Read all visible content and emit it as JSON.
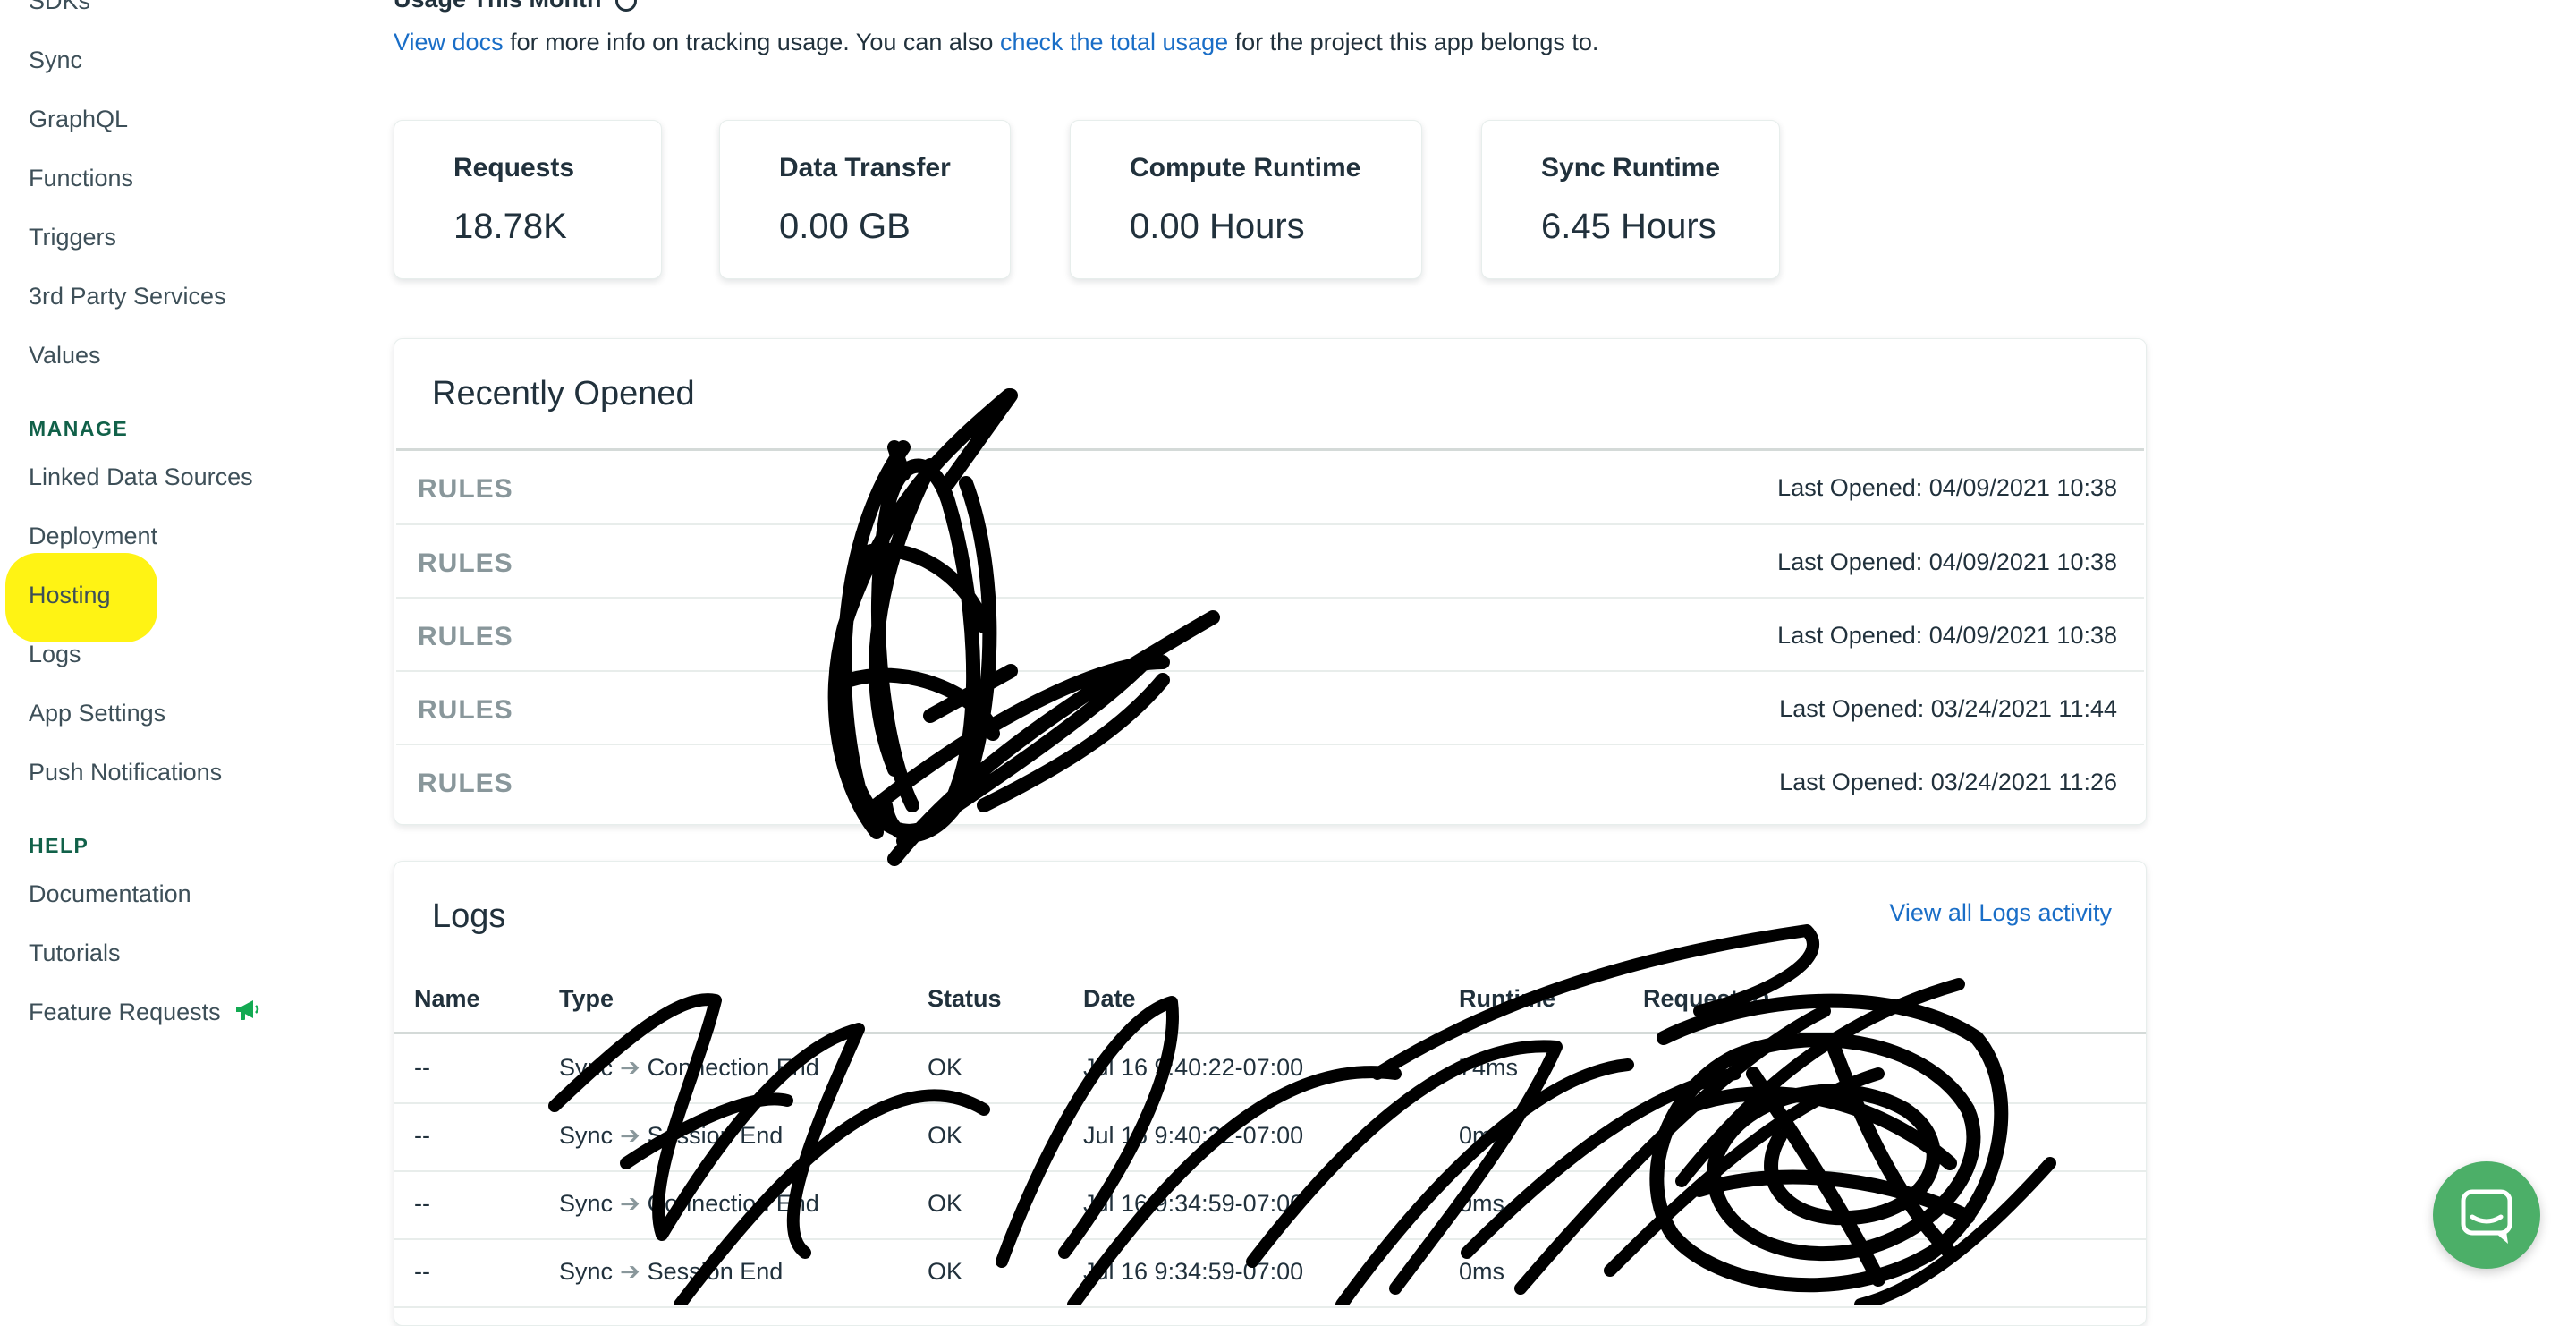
{
  "sidebar": {
    "items_top": [
      "SDKs",
      "Sync",
      "GraphQL",
      "Functions",
      "Triggers",
      "3rd Party Services",
      "Values"
    ],
    "manage_heading": "MANAGE",
    "manage_items": [
      "Linked Data Sources",
      "Deployment",
      "Hosting",
      "Logs",
      "App Settings",
      "Push Notifications"
    ],
    "help_heading": "HELP",
    "help_items": [
      "Documentation",
      "Tutorials",
      "Feature Requests"
    ],
    "highlight_color": "#fff200"
  },
  "usage": {
    "heading": "Usage This Month",
    "link_docs": "View docs",
    "text_1": " for more info on tracking usage. You can also ",
    "link_total": "check the total usage",
    "text_2": " for the project this app belongs to."
  },
  "cards": [
    {
      "label": "Requests",
      "value": "18.78K"
    },
    {
      "label": "Data Transfer",
      "value": "0.00 GB"
    },
    {
      "label": "Compute Runtime",
      "value": "0.00 Hours"
    },
    {
      "label": "Sync Runtime",
      "value": "6.45 Hours"
    }
  ],
  "recently_opened": {
    "title": "Recently Opened",
    "rows": [
      {
        "name": "RULES",
        "last_opened": "Last Opened: 04/09/2021 10:38"
      },
      {
        "name": "RULES",
        "last_opened": "Last Opened: 04/09/2021 10:38"
      },
      {
        "name": "RULES",
        "last_opened": "Last Opened: 04/09/2021 10:38"
      },
      {
        "name": "RULES",
        "last_opened": "Last Opened: 03/24/2021 11:44"
      },
      {
        "name": "RULES",
        "last_opened": "Last Opened: 03/24/2021 11:26"
      }
    ]
  },
  "logs": {
    "title": "Logs",
    "view_all": "View all Logs activity",
    "columns": [
      "Name",
      "Type",
      "Status",
      "Date",
      "Runtime",
      "Request ID"
    ],
    "rows": [
      {
        "name": "--",
        "type_a": "Sync",
        "type_b": "Connection End",
        "status": "OK",
        "date": "Jul 16 9:40:22-07:00",
        "runtime": "74ms"
      },
      {
        "name": "--",
        "type_a": "Sync",
        "type_b": "Session End",
        "status": "OK",
        "date": "Jul 16 9:40:22-07:00",
        "runtime": "0ms"
      },
      {
        "name": "--",
        "type_a": "Sync",
        "type_b": "Connection End",
        "status": "OK",
        "date": "Jul 16 9:34:59-07:00",
        "runtime": "0ms"
      },
      {
        "name": "--",
        "type_a": "Sync",
        "type_b": "Session End",
        "status": "OK",
        "date": "Jul 16 9:34:59-07:00",
        "runtime": "0ms"
      }
    ]
  },
  "colors": {
    "link": "#1a6ec7",
    "section_heading": "#116149",
    "chat_button": "#4caf68"
  },
  "icons": {
    "megaphone": "megaphone-icon",
    "info": "info-icon",
    "chat": "chat-icon",
    "arrow": "right-arrow-icon"
  }
}
